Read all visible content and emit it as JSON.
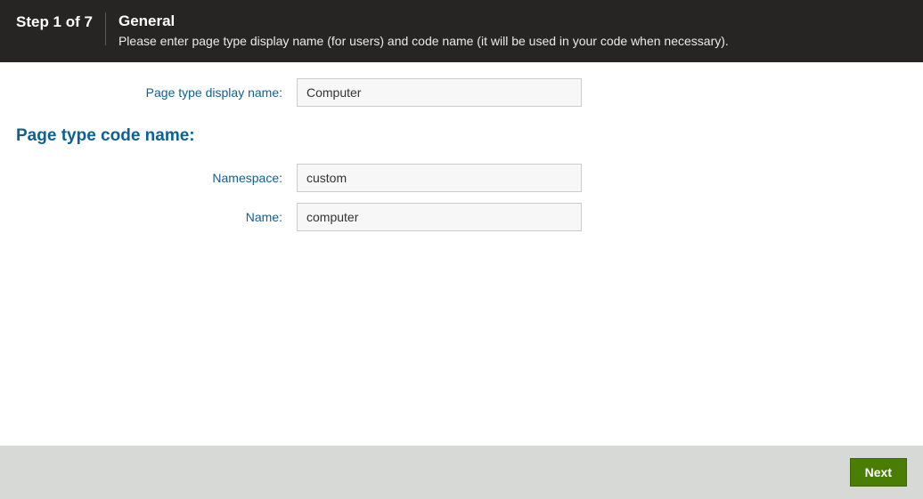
{
  "header": {
    "step_indicator": "Step 1 of 7",
    "title": "General",
    "description": "Please enter page type display name (for users) and code name (it will be used in your code when necessary)."
  },
  "form": {
    "display_name_label": "Page type display name:",
    "display_name_value": "Computer",
    "section_heading": "Page type code name:",
    "namespace_label": "Namespace:",
    "namespace_value": "custom",
    "name_label": "Name:",
    "name_value": "computer"
  },
  "footer": {
    "next_label": "Next"
  }
}
